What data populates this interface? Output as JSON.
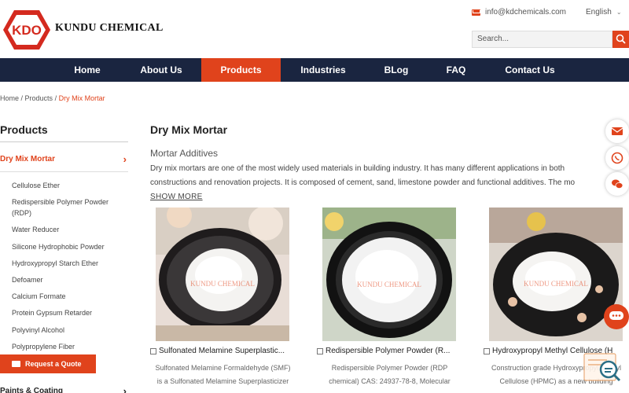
{
  "header": {
    "logo_text": "KDO",
    "brand_name": "KUNDU CHEMICAL",
    "email": "info@kdchemicals.com",
    "language": "English",
    "search_placeholder": "Search..."
  },
  "nav": {
    "items": [
      {
        "label": "Home"
      },
      {
        "label": "About Us"
      },
      {
        "label": "Products"
      },
      {
        "label": "Industries"
      },
      {
        "label": "BLog"
      },
      {
        "label": "FAQ"
      },
      {
        "label": "Contact Us"
      }
    ],
    "active": "Products"
  },
  "breadcrumb": {
    "home": "Home",
    "sep": " / ",
    "products": "Products",
    "current": "Dry Mix Mortar"
  },
  "sidebar": {
    "title": "Products",
    "active_category": "Dry Mix Mortar",
    "items": [
      {
        "label": "Cellulose Ether"
      },
      {
        "label": "Redispersible Polymer Powder (RDP)"
      },
      {
        "label": "Water Reducer"
      },
      {
        "label": "Silicone Hydrophobic Powder"
      },
      {
        "label": "Hydroxypropyl Starch Ether"
      },
      {
        "label": "Defoamer"
      },
      {
        "label": "Calcium Formate"
      },
      {
        "label": "Protein Gypsum Retarder"
      },
      {
        "label": "Polyvinyl Alcohol"
      },
      {
        "label": "Polypropylene Fiber"
      }
    ],
    "quote_button": "Request a Quote",
    "next_category": "Paints & Coating"
  },
  "main": {
    "title": "Dry Mix Mortar",
    "subtitle": "Mortar Additives",
    "description_line1": "Dry mix mortars are one of the most widely used materials in building industry. It has many different applications in both",
    "description_line2": "constructions and renovation projects. It is composed of cement, sand, limestone powder and functional additives. The mo",
    "show_more": "SHOW MORE",
    "products": [
      {
        "title": "Sulfonated Melamine Superplastic...",
        "desc_line1": "Sulfonated Melamine Formaldehyde (SMF)",
        "desc_line2": "is a Sulfonated Melamine Superplasticizer",
        "watermark": "KUNDU CHEMICAL"
      },
      {
        "title": "Redispersible Polymer Powder (R...",
        "desc_line1": "Redispersible Polymer Powder (RDP",
        "desc_line2": "chemical) CAS: 24937-78-8, Molecular",
        "watermark": "KUNDU CHEMICAL"
      },
      {
        "title": "Hydroxypropyl Methyl Cellulose (H",
        "desc_line1": "Construction grade Hydroxypropyl Methyl",
        "desc_line2": "Cellulose (HPMC) as a new building",
        "watermark": "KUNDU CHEMICAL"
      }
    ]
  },
  "floating": {
    "icons": [
      "mail-icon",
      "whatsapp-icon",
      "wechat-icon",
      "chat-icon",
      "scan-icon"
    ]
  },
  "colors": {
    "accent": "#e0431c",
    "nav_bg": "#1a2540"
  }
}
